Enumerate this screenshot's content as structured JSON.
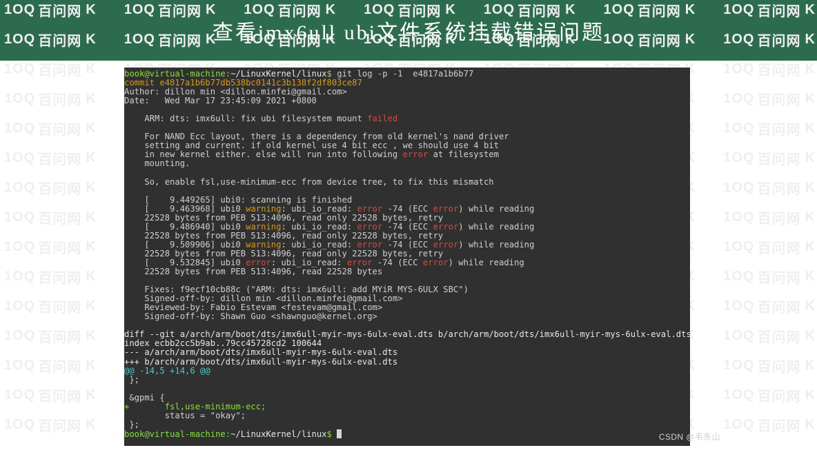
{
  "banner": {
    "title": "查看imx6ull ubi文件系统挂载错误问题"
  },
  "watermark": {
    "text": "百问网",
    "suffix": "K",
    "logo": "1OQ"
  },
  "csdn": "CSDN @韦东山",
  "term": {
    "prompt_user": "book@virtual-machine",
    "prompt_path": "~/LinuxKernel/linux",
    "cmd": "git log -p -1  e4817a1b6b77",
    "commit": "commit e4817a1b6b77db538bc0141c3b138f2df803ce87",
    "author": "Author: dillon min <dillon.minfei@gmail.com>",
    "date": "Date:   Wed Mar 17 23:45:09 2021 +0800",
    "subj1": "    ARM: dts: imx6ull: fix ubi filesystem mount ",
    "subj1_red": "failed",
    "body1": "    For NAND Ecc layout, there is a dependency from old kernel's nand driver",
    "body2": "    setting and current. if old kernel use 4 bit ecc , we should use 4 bit",
    "body3a": "    in new kernel either. else will run into following ",
    "body3_err": "error",
    "body3b": " at filesystem",
    "body4": "    mounting.",
    "body5": "    So, enable fsl,use-minimum-ecc from device tree, to fix this mismatch",
    "log1": "    [    9.449265] ubi0: scanning is finished",
    "log2a": "    [    9.463968] ubi0 ",
    "warn": "warning",
    "log2b": ": ubi_io_read: ",
    "err": "error",
    "ecc": " -74 (ECC ",
    "tail": ") while reading",
    "wrap1": "    22528 bytes from PEB 513:4096, read only 22528 bytes, retry",
    "log3a": "    [    9.486940] ubi0 ",
    "log4a": "    [    9.509906] ubi0 ",
    "log5a": "    [    9.532845] ubi0 ",
    "wrap_last": "    22528 bytes from PEB 513:4096, read 22528 bytes",
    "fixes": "    Fixes: f9ecf10cb88c (\"ARM: dts: imx6ull: add MYiR MYS-6ULX SBC\")",
    "soff1": "    Signed-off-by: dillon min <dillon.minfei@gmail.com>",
    "rev": "    Reviewed-by: Fabio Estevam <festevam@gmail.com>",
    "soff2": "    Signed-off-by: Shawn Guo <shawnguo@kernel.org>",
    "diff1": "diff --git a/arch/arm/boot/dts/imx6ull-myir-mys-6ulx-eval.dts b/arch/arm/boot/dts/imx6ull-myir-mys-6ulx-eval.dts",
    "diff2": "index ecbb2cc5b9ab..79cc45728cd2 100644",
    "diff3": "--- a/arch/arm/boot/dts/imx6ull-myir-mys-6ulx-eval.dts",
    "diff4": "+++ b/arch/arm/boot/dts/imx6ull-myir-mys-6ulx-eval.dts",
    "hunk": "@@ -14,5 +14,6 @@",
    "ctx1": " };",
    "ctx2": " ",
    "ctx3": " &gpmi {",
    "add": "+       fsl,use-minimum-ecc;",
    "ctx4": "        status = \"okay\";",
    "ctx5": " };"
  }
}
